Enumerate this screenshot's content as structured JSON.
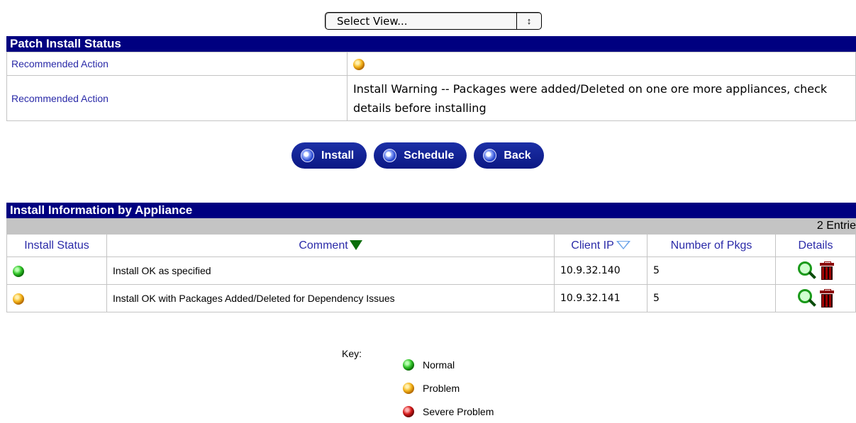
{
  "select_view": {
    "label": "Select View...",
    "arrows": "↕"
  },
  "patch_status": {
    "header": "Patch Install Status",
    "rows": [
      {
        "key": "Recommended Action",
        "status_color": "orange"
      },
      {
        "key": "Recommended Action",
        "value": "Install Warning -- Packages were added/Deleted on one ore more appliances, check details before installing"
      }
    ]
  },
  "buttons": {
    "install": "Install",
    "schedule": "Schedule",
    "back": "Back"
  },
  "install_info": {
    "header": "Install Information by Appliance",
    "entries": "2 Entrie",
    "columns": [
      "Install Status",
      "Comment",
      "Client IP",
      "Number of Pkgs",
      "Details"
    ],
    "rows": [
      {
        "status": "green",
        "comment": "Install OK as specified",
        "ip": "10.9.32.140",
        "pkgs": "5"
      },
      {
        "status": "orange",
        "comment": "Install OK with Packages Added/Deleted for Dependency Issues",
        "ip": "10.9.32.141",
        "pkgs": "5"
      }
    ]
  },
  "key": {
    "label": "Key:",
    "items": [
      {
        "color": "green",
        "label": "Normal"
      },
      {
        "color": "orange",
        "label": "Problem"
      },
      {
        "color": "red",
        "label": "Severe Problem"
      }
    ]
  },
  "colors": {
    "header_bg": "#000080",
    "link": "#2a2aa8",
    "border": "#c4c4c4"
  }
}
